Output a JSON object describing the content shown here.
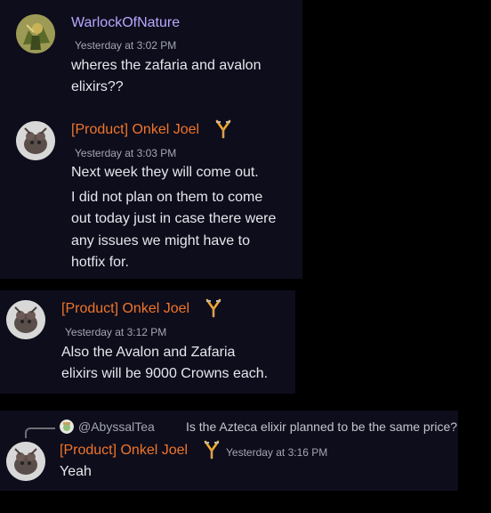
{
  "messages": [
    {
      "author": "WarlockOfNature",
      "author_color": "#b9a8ff",
      "timestamp": "Yesterday at 3:02 PM",
      "lines": [
        "wheres the zafaria and avalon",
        "elixirs??"
      ]
    },
    {
      "author": "[Product] Onkel Joel",
      "author_color": "#f0752a",
      "role_icon": "crossed-tools-badge-icon",
      "timestamp": "Yesterday at 3:03 PM",
      "line1": "Next week they will come out.",
      "lines": [
        "I did not plan on them to come",
        "out today just in case there were",
        "any issues we might have to",
        "hotfix for."
      ]
    },
    {
      "author": "[Product] Onkel Joel",
      "author_color": "#f0752a",
      "role_icon": "crossed-tools-badge-icon",
      "timestamp": "Yesterday at 3:12 PM",
      "lines": [
        "Also the Avalon and Zafaria",
        "elixirs will be 9000 Crowns each."
      ]
    },
    {
      "reply": {
        "author": "@AbyssalTea",
        "text": "Is the Azteca elixir planned to be the same price?"
      },
      "author": "[Product] Onkel Joel",
      "author_color": "#f0752a",
      "role_icon": "crossed-tools-badge-icon",
      "timestamp": "Yesterday at 3:16 PM",
      "lines": [
        "Yeah"
      ]
    }
  ],
  "colors": {
    "background": "#000000",
    "message_background": "#0e0d1c",
    "timestamp": "#a3a6b0",
    "text": "#e6e6ec"
  }
}
